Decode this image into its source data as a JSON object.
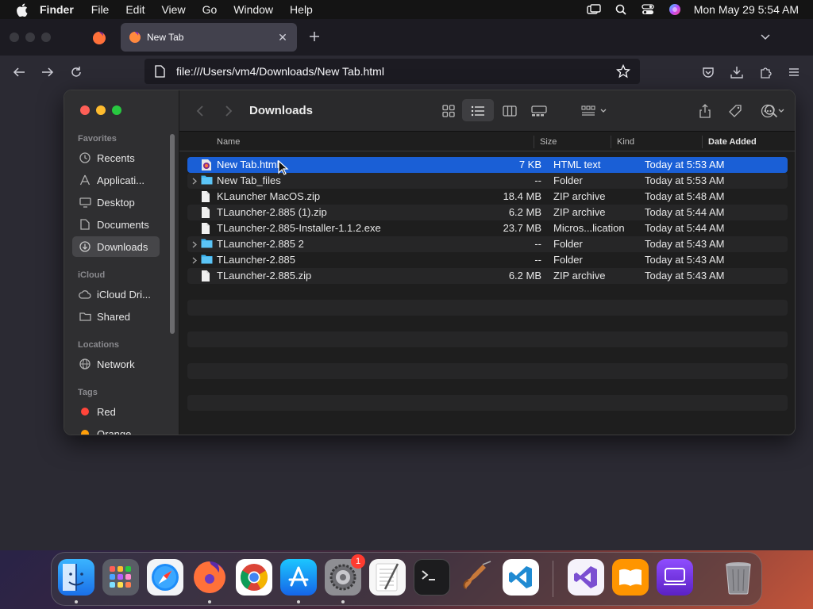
{
  "menubar": {
    "app_name": "Finder",
    "menus": [
      "File",
      "Edit",
      "View",
      "Go",
      "Window",
      "Help"
    ],
    "clock": "Mon May 29  5:54 AM"
  },
  "browser": {
    "tab_title": "New Tab",
    "url": "file:///Users/vm4/Downloads/New Tab.html"
  },
  "finder": {
    "title": "Downloads",
    "sidebar": {
      "favorites_label": "Favorites",
      "favorites": [
        {
          "label": "Recents",
          "icon": "clock-icon"
        },
        {
          "label": "Applicati...",
          "icon": "applications-icon"
        },
        {
          "label": "Desktop",
          "icon": "desktop-icon"
        },
        {
          "label": "Documents",
          "icon": "document-icon"
        },
        {
          "label": "Downloads",
          "icon": "download-icon",
          "active": true
        }
      ],
      "icloud_label": "iCloud",
      "icloud": [
        {
          "label": "iCloud Dri...",
          "icon": "cloud-icon"
        },
        {
          "label": "Shared",
          "icon": "shared-folder-icon"
        }
      ],
      "locations_label": "Locations",
      "locations": [
        {
          "label": "Network",
          "icon": "globe-icon"
        }
      ],
      "tags_label": "Tags",
      "tags": [
        {
          "label": "Red",
          "color": "#ff453a"
        },
        {
          "label": "Orange",
          "color": "#ff9f0a"
        }
      ]
    },
    "columns": {
      "name": "Name",
      "size": "Size",
      "kind": "Kind",
      "date": "Date Added"
    },
    "files": [
      {
        "name": "New Tab.html",
        "size": "7 KB",
        "kind": "HTML text",
        "date": "Today at 5:53 AM",
        "type": "html",
        "selected": true
      },
      {
        "name": "New Tab_files",
        "size": "--",
        "kind": "Folder",
        "date": "Today at 5:53 AM",
        "type": "folder"
      },
      {
        "name": "KLauncher MacOS.zip",
        "size": "18.4 MB",
        "kind": "ZIP archive",
        "date": "Today at 5:48 AM",
        "type": "file"
      },
      {
        "name": "TLauncher-2.885 (1).zip",
        "size": "6.2 MB",
        "kind": "ZIP archive",
        "date": "Today at 5:44 AM",
        "type": "file"
      },
      {
        "name": "TLauncher-2.885-Installer-1.1.2.exe",
        "size": "23.7 MB",
        "kind": "Micros...lication",
        "date": "Today at 5:44 AM",
        "type": "file"
      },
      {
        "name": "TLauncher-2.885 2",
        "size": "--",
        "kind": "Folder",
        "date": "Today at 5:43 AM",
        "type": "folder"
      },
      {
        "name": "TLauncher-2.885",
        "size": "--",
        "kind": "Folder",
        "date": "Today at 5:43 AM",
        "type": "folder"
      },
      {
        "name": "TLauncher-2.885.zip",
        "size": "6.2 MB",
        "kind": "ZIP archive",
        "date": "Today at 5:43 AM",
        "type": "file"
      }
    ]
  },
  "dock": {
    "apps": [
      "finder-icon",
      "launchpad-icon",
      "safari-icon",
      "firefox-icon",
      "chrome-icon",
      "app-store-icon",
      "system-settings-icon",
      "textedit-icon",
      "terminal-icon",
      "garageband-icon",
      "vscode-icon",
      "visual-studio-icon",
      "books-icon",
      "apple-configurator-icon",
      "trash-icon"
    ],
    "settings_badge": "1"
  }
}
